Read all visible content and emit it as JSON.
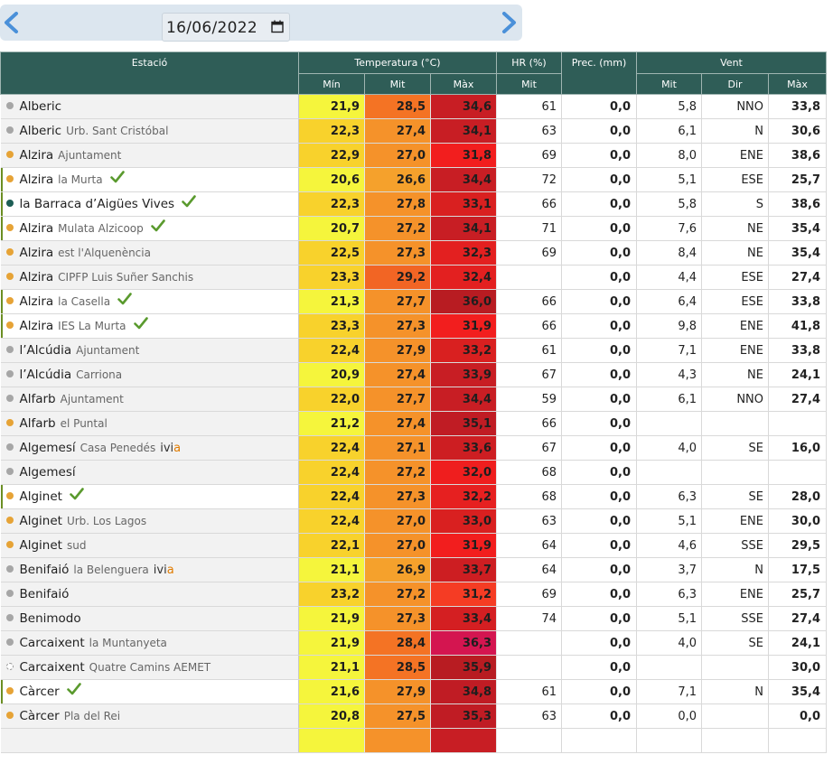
{
  "date": "16/06/2022",
  "header": {
    "station": "Estació",
    "temperature": "Temperatura (°C)",
    "hr": "HR (%)",
    "prec": "Prec. (mm)",
    "wind": "Vent",
    "min": "Mín",
    "mit": "Mit",
    "max": "Màx",
    "hr_mit": "Mit",
    "wind_mit": "Mit",
    "wind_dir": "Dir",
    "wind_max": "Màx"
  },
  "colors": {
    "dot_gray": "#a6a6a6",
    "dot_orange": "#e6a336",
    "dot_teal": "#1d5e55",
    "check": "#5a9a2e"
  },
  "rows": [
    {
      "name": "Alberic",
      "sub": "",
      "dot": "gray",
      "check": false,
      "ivia": false,
      "white": false,
      "min": "21,9",
      "mit": "28,5",
      "max": "34,6",
      "hr": "61",
      "prec": "0,0",
      "wmit": "5,8",
      "wdir": "NNO",
      "wmax": "33,8",
      "cmin": "#f5f53c",
      "cmit": "#f47324",
      "cmax": "#c81e24"
    },
    {
      "name": "Alberic",
      "sub": "Urb. Sant Cristóbal",
      "dot": "gray",
      "check": false,
      "ivia": false,
      "white": false,
      "min": "22,3",
      "mit": "27,4",
      "max": "34,1",
      "hr": "63",
      "prec": "0,0",
      "wmit": "6,1",
      "wdir": "N",
      "wmax": "30,6",
      "cmin": "#f8d22c",
      "cmit": "#f5922a",
      "cmax": "#c81e24"
    },
    {
      "name": "Alzira",
      "sub": "Ajuntament",
      "dot": "orange",
      "check": false,
      "ivia": false,
      "white": false,
      "min": "22,9",
      "mit": "27,0",
      "max": "31,8",
      "hr": "69",
      "prec": "0,0",
      "wmit": "8,0",
      "wdir": "ENE",
      "wmax": "38,6",
      "cmin": "#f8d22c",
      "cmit": "#f5922a",
      "cmax": "#f21e1e"
    },
    {
      "name": "Alzira",
      "sub": "la Murta",
      "dot": "orange",
      "check": true,
      "ivia": false,
      "white": true,
      "min": "20,6",
      "mit": "26,6",
      "max": "34,4",
      "hr": "72",
      "prec": "0,0",
      "wmit": "5,1",
      "wdir": "ESE",
      "wmax": "25,7",
      "cmin": "#f5f53c",
      "cmit": "#f5a12c",
      "cmax": "#c81e24"
    },
    {
      "name": "la Barraca d’Aigües Vives",
      "sub": "",
      "dot": "teal",
      "check": true,
      "ivia": false,
      "white": true,
      "min": "22,3",
      "mit": "27,8",
      "max": "33,1",
      "hr": "66",
      "prec": "0,0",
      "wmit": "5,8",
      "wdir": "S",
      "wmax": "38,6",
      "cmin": "#f8d22c",
      "cmit": "#f5922a",
      "cmax": "#d92020"
    },
    {
      "name": "Alzira",
      "sub": "Mulata Alzicoop",
      "dot": "orange",
      "check": true,
      "ivia": false,
      "white": true,
      "min": "20,7",
      "mit": "27,2",
      "max": "34,1",
      "hr": "71",
      "prec": "0,0",
      "wmit": "7,6",
      "wdir": "NE",
      "wmax": "35,4",
      "cmin": "#f5f53c",
      "cmit": "#f5922a",
      "cmax": "#c81e24"
    },
    {
      "name": "Alzira",
      "sub": "est l'Alquenència",
      "dot": "orange",
      "check": false,
      "ivia": false,
      "white": false,
      "min": "22,5",
      "mit": "27,3",
      "max": "32,3",
      "hr": "69",
      "prec": "0,0",
      "wmit": "8,4",
      "wdir": "NE",
      "wmax": "35,4",
      "cmin": "#f8d22c",
      "cmit": "#f5922a",
      "cmax": "#e32020"
    },
    {
      "name": "Alzira",
      "sub": "CIPFP Luis Suñer Sanchis",
      "dot": "orange",
      "check": false,
      "ivia": false,
      "white": false,
      "min": "23,3",
      "mit": "29,2",
      "max": "32,4",
      "hr": "",
      "prec": "0,0",
      "wmit": "4,4",
      "wdir": "ESE",
      "wmax": "27,4",
      "cmin": "#f8d22c",
      "cmit": "#f26524",
      "cmax": "#e32020"
    },
    {
      "name": "Alzira",
      "sub": "la Casella",
      "dot": "orange",
      "check": true,
      "ivia": false,
      "white": true,
      "min": "21,3",
      "mit": "27,7",
      "max": "36,0",
      "hr": "66",
      "prec": "0,0",
      "wmit": "6,4",
      "wdir": "ESE",
      "wmax": "33,8",
      "cmin": "#f5f53c",
      "cmit": "#f5922a",
      "cmax": "#b81c22"
    },
    {
      "name": "Alzira",
      "sub": "IES La Murta",
      "dot": "orange",
      "check": true,
      "ivia": false,
      "white": true,
      "min": "23,3",
      "mit": "27,3",
      "max": "31,9",
      "hr": "66",
      "prec": "0,0",
      "wmit": "9,8",
      "wdir": "ENE",
      "wmax": "41,8",
      "cmin": "#f8d22c",
      "cmit": "#f5922a",
      "cmax": "#f21e1e"
    },
    {
      "name": "l’Alcúdia",
      "sub": "Ajuntament",
      "dot": "gray",
      "check": false,
      "ivia": false,
      "white": false,
      "min": "22,4",
      "mit": "27,9",
      "max": "33,2",
      "hr": "61",
      "prec": "0,0",
      "wmit": "7,1",
      "wdir": "ENE",
      "wmax": "33,8",
      "cmin": "#f8d22c",
      "cmit": "#f5922a",
      "cmax": "#d92020"
    },
    {
      "name": "l’Alcúdia",
      "sub": "Carriona",
      "dot": "gray",
      "check": false,
      "ivia": false,
      "white": false,
      "min": "20,9",
      "mit": "27,4",
      "max": "33,9",
      "hr": "67",
      "prec": "0,0",
      "wmit": "4,3",
      "wdir": "NE",
      "wmax": "24,1",
      "cmin": "#f5f53c",
      "cmit": "#f5922a",
      "cmax": "#c81e24"
    },
    {
      "name": "Alfarb",
      "sub": "Ajuntament",
      "dot": "gray",
      "check": false,
      "ivia": false,
      "white": false,
      "min": "22,0",
      "mit": "27,7",
      "max": "34,4",
      "hr": "59",
      "prec": "0,0",
      "wmit": "6,1",
      "wdir": "NNO",
      "wmax": "27,4",
      "cmin": "#f8d22c",
      "cmit": "#f5922a",
      "cmax": "#c81e24"
    },
    {
      "name": "Alfarb",
      "sub": "el Puntal",
      "dot": "orange",
      "check": false,
      "ivia": false,
      "white": false,
      "min": "21,2",
      "mit": "27,4",
      "max": "35,1",
      "hr": "66",
      "prec": "0,0",
      "wmit": "",
      "wdir": "",
      "wmax": "",
      "cmin": "#f5f53c",
      "cmit": "#f5922a",
      "cmax": "#c01c24"
    },
    {
      "name": "Algemesí",
      "sub": "Casa Penedés",
      "dot": "gray",
      "check": false,
      "ivia": true,
      "white": false,
      "min": "22,4",
      "mit": "27,1",
      "max": "33,6",
      "hr": "67",
      "prec": "0,0",
      "wmit": "4,0",
      "wdir": "SE",
      "wmax": "16,0",
      "cmin": "#f8d22c",
      "cmit": "#f5922a",
      "cmax": "#cd1e22"
    },
    {
      "name": "Algemesí",
      "sub": "",
      "dot": "gray",
      "check": false,
      "ivia": false,
      "white": false,
      "min": "22,4",
      "mit": "27,2",
      "max": "32,0",
      "hr": "68",
      "prec": "0,0",
      "wmit": "",
      "wdir": "",
      "wmax": "",
      "cmin": "#f8d22c",
      "cmit": "#f5922a",
      "cmax": "#ef1e1e"
    },
    {
      "name": "Alginet",
      "sub": "",
      "dot": "orange",
      "check": true,
      "ivia": false,
      "white": true,
      "min": "22,4",
      "mit": "27,3",
      "max": "32,2",
      "hr": "68",
      "prec": "0,0",
      "wmit": "6,3",
      "wdir": "SE",
      "wmax": "28,0",
      "cmin": "#f8d22c",
      "cmit": "#f5922a",
      "cmax": "#e62020"
    },
    {
      "name": "Alginet",
      "sub": "Urb. Los Lagos",
      "dot": "orange",
      "check": false,
      "ivia": false,
      "white": false,
      "min": "22,4",
      "mit": "27,0",
      "max": "33,0",
      "hr": "63",
      "prec": "0,0",
      "wmit": "5,1",
      "wdir": "ENE",
      "wmax": "30,0",
      "cmin": "#f8d22c",
      "cmit": "#f5922a",
      "cmax": "#d92020"
    },
    {
      "name": "Alginet",
      "sub": "sud",
      "dot": "orange",
      "check": false,
      "ivia": false,
      "white": false,
      "min": "22,1",
      "mit": "27,0",
      "max": "31,9",
      "hr": "64",
      "prec": "0,0",
      "wmit": "4,6",
      "wdir": "SSE",
      "wmax": "29,5",
      "cmin": "#f8d22c",
      "cmit": "#f5922a",
      "cmax": "#f21e1e"
    },
    {
      "name": "Benifaió",
      "sub": "la Belenguera",
      "dot": "gray",
      "check": false,
      "ivia": true,
      "white": false,
      "min": "21,1",
      "mit": "26,9",
      "max": "33,7",
      "hr": "64",
      "prec": "0,0",
      "wmit": "3,7",
      "wdir": "N",
      "wmax": "17,5",
      "cmin": "#f5f53c",
      "cmit": "#f5a12c",
      "cmax": "#cd1e22"
    },
    {
      "name": "Benifaió",
      "sub": "",
      "dot": "gray",
      "check": false,
      "ivia": false,
      "white": false,
      "min": "23,2",
      "mit": "27,2",
      "max": "31,2",
      "hr": "69",
      "prec": "0,0",
      "wmit": "6,3",
      "wdir": "ENE",
      "wmax": "25,7",
      "cmin": "#f8d22c",
      "cmit": "#f5922a",
      "cmax": "#f53c24"
    },
    {
      "name": "Benimodo",
      "sub": "",
      "dot": "gray",
      "check": false,
      "ivia": false,
      "white": false,
      "min": "21,9",
      "mit": "27,3",
      "max": "33,4",
      "hr": "74",
      "prec": "0,0",
      "wmit": "5,1",
      "wdir": "SSE",
      "wmax": "27,4",
      "cmin": "#f5f53c",
      "cmit": "#f5922a",
      "cmax": "#d41f22"
    },
    {
      "name": "Carcaixent",
      "sub": "la Muntanyeta",
      "dot": "gray",
      "check": false,
      "ivia": false,
      "white": false,
      "min": "21,9",
      "mit": "28,4",
      "max": "36,3",
      "hr": "",
      "prec": "0,0",
      "wmit": "4,0",
      "wdir": "SE",
      "wmax": "24,1",
      "cmin": "#f5f53c",
      "cmit": "#f47324",
      "cmax": "#d41550"
    },
    {
      "name": "Carcaixent",
      "sub": "Quatre Camins AEMET",
      "dot": "hollow",
      "check": false,
      "ivia": false,
      "white": false,
      "min": "21,1",
      "mit": "28,5",
      "max": "35,9",
      "hr": "",
      "prec": "0,0",
      "wmit": "",
      "wdir": "",
      "wmax": "30,0",
      "cmin": "#f5f53c",
      "cmit": "#f47324",
      "cmax": "#b81c22"
    },
    {
      "name": "Càrcer",
      "sub": "",
      "dot": "orange",
      "check": true,
      "ivia": false,
      "white": true,
      "min": "21,6",
      "mit": "27,9",
      "max": "34,8",
      "hr": "61",
      "prec": "0,0",
      "wmit": "7,1",
      "wdir": "N",
      "wmax": "35,4",
      "cmin": "#f5f53c",
      "cmit": "#f5922a",
      "cmax": "#c01c24"
    },
    {
      "name": "Càrcer",
      "sub": "Pla del Rei",
      "dot": "orange",
      "check": false,
      "ivia": false,
      "white": false,
      "min": "20,8",
      "mit": "27,5",
      "max": "35,3",
      "hr": "63",
      "prec": "0,0",
      "wmit": "0,0",
      "wdir": "",
      "wmax": "0,0",
      "cmin": "#f5f53c",
      "cmit": "#f5922a",
      "cmax": "#c01c24"
    },
    {
      "name": "",
      "sub": "",
      "dot": "none",
      "check": false,
      "ivia": false,
      "white": false,
      "min": "",
      "mit": "",
      "max": "",
      "hr": "",
      "prec": "",
      "wmit": "",
      "wdir": "",
      "wmax": "",
      "cmin": "#f5f53c",
      "cmit": "#f5922a",
      "cmax": "#c81e24"
    }
  ]
}
